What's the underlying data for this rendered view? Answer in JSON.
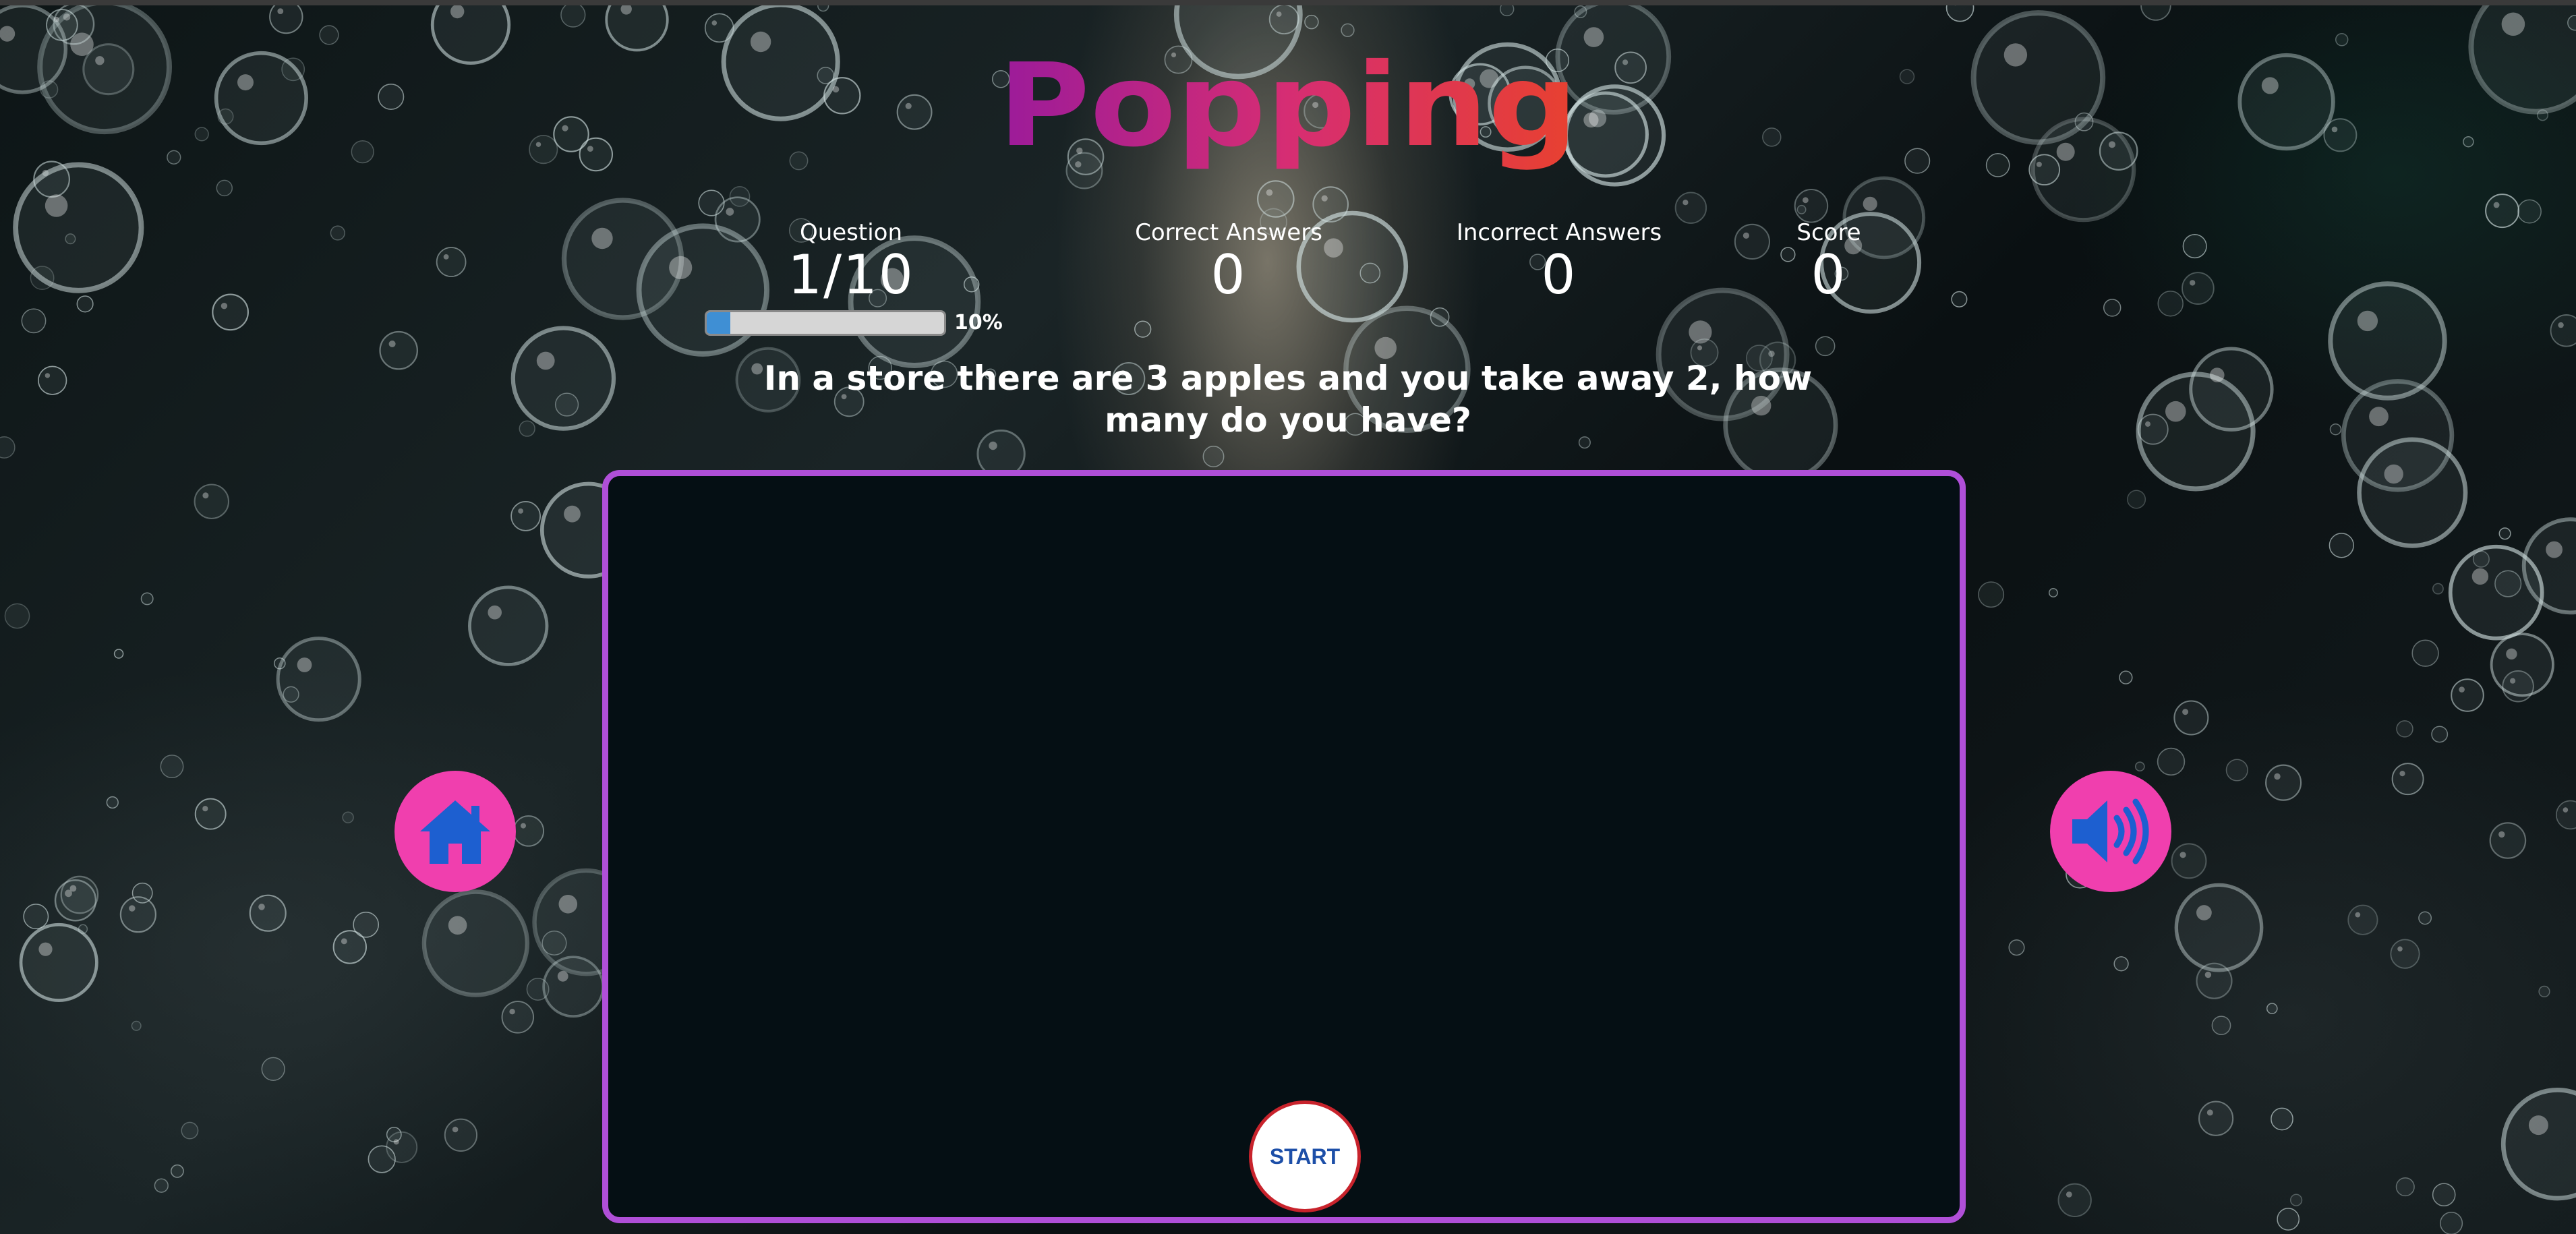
{
  "title": "Popping",
  "colors": {
    "title_gradient_start": "#9b1b9a",
    "title_gradient_mid": "#d62d73",
    "title_gradient_end": "#e8412f",
    "game_border": "#b04fd8",
    "side_button_bg": "#f03fae",
    "icon_blue": "#1d5fd0",
    "start_border": "#c8232c",
    "start_text": "#1d4fa8",
    "progress_fill": "#3f8fd4"
  },
  "stats": {
    "question": {
      "label": "Question",
      "value": "1/10"
    },
    "correct": {
      "label": "Correct Answers",
      "value": "0"
    },
    "incorrect": {
      "label": "Incorrect Answers",
      "value": "0"
    },
    "score": {
      "label": "Score",
      "value": "0"
    }
  },
  "progress": {
    "percent": 10,
    "text": "10%"
  },
  "question_text": "In a store there are 3 apples and you take away 2, how many do you have?",
  "buttons": {
    "start_label": "START",
    "home_icon": "home-icon",
    "sound_icon": "speaker-volume-icon"
  }
}
